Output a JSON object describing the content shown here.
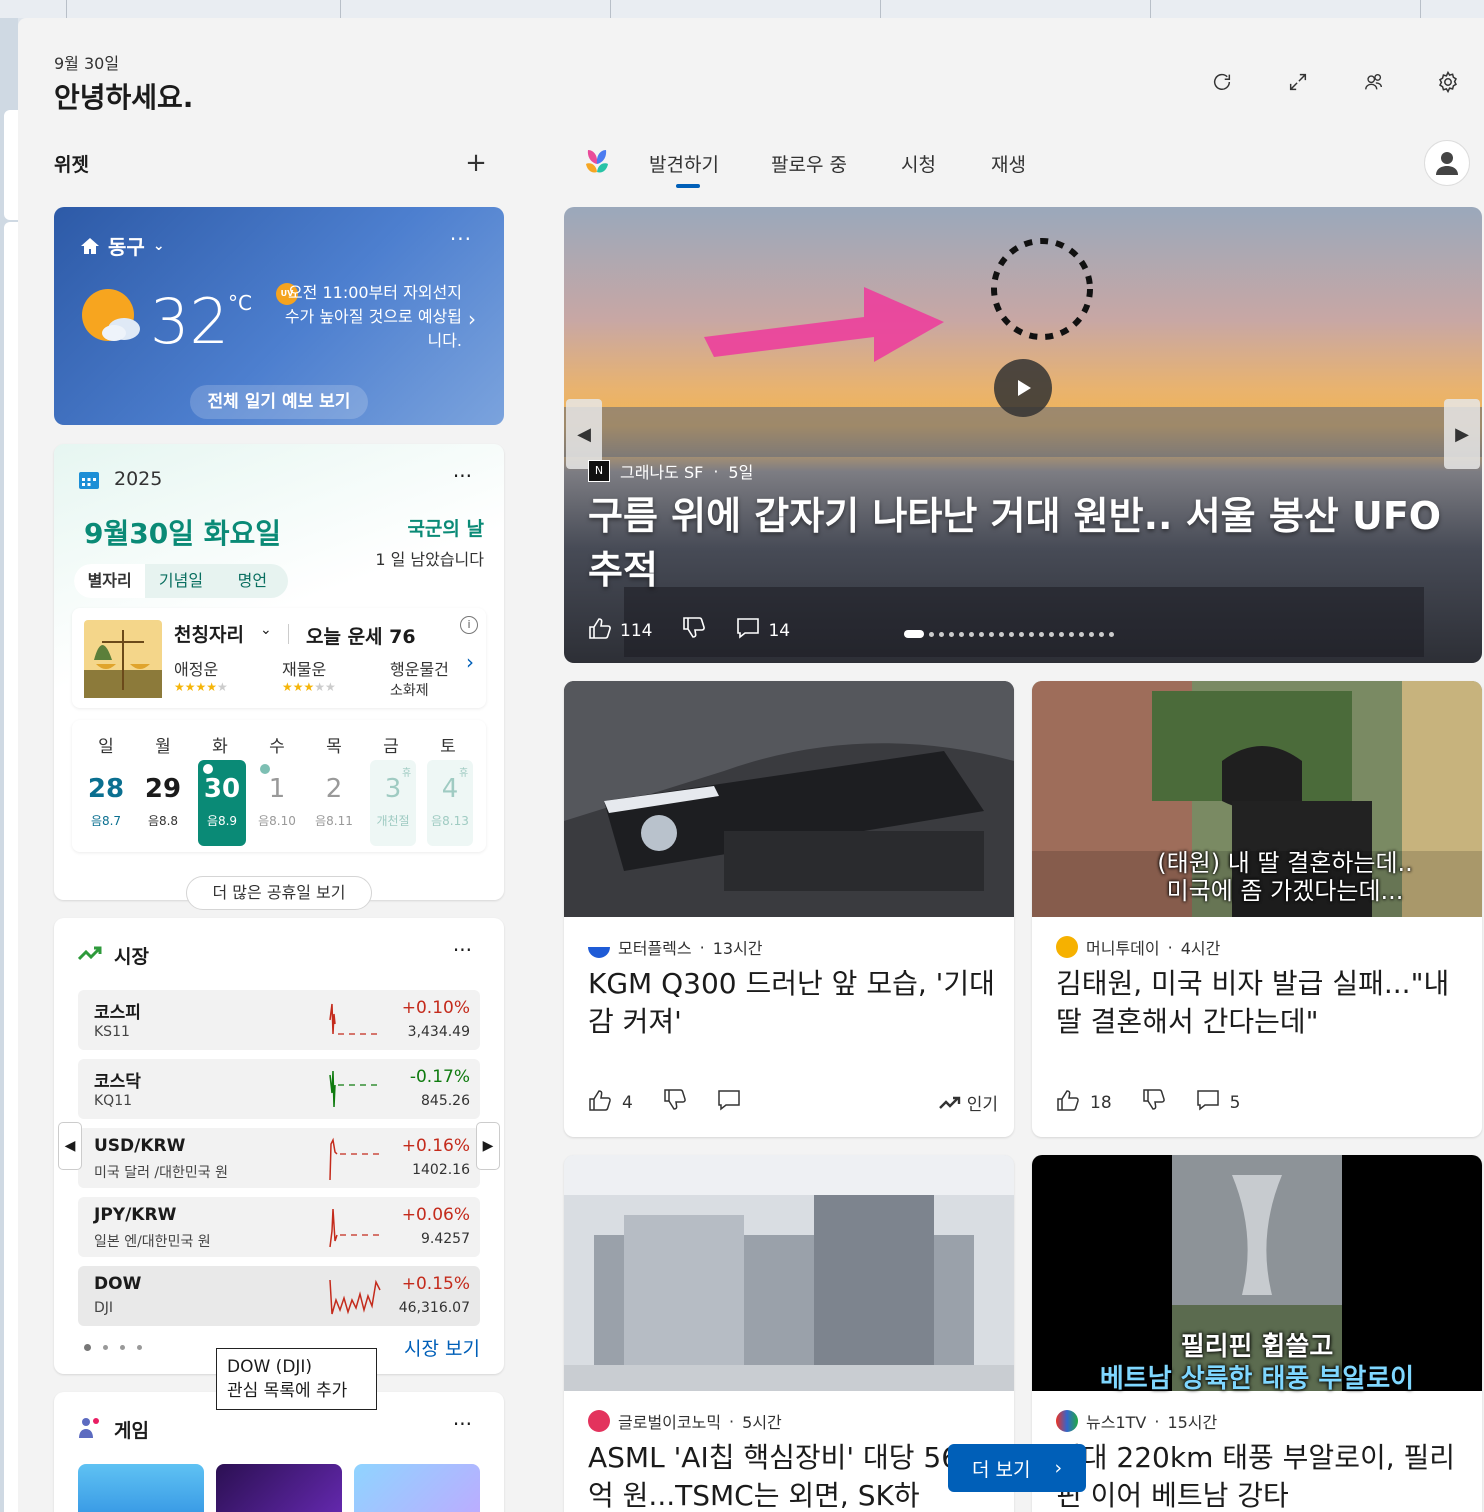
{
  "header": {
    "date": "9월 30일",
    "greeting": "안녕하세요."
  },
  "widgets": {
    "title": "위젯",
    "add_label": "+"
  },
  "feed_tabs": [
    {
      "label": "발견하기",
      "active": true
    },
    {
      "label": "팔로우 중",
      "active": false
    },
    {
      "label": "시청",
      "active": false
    },
    {
      "label": "재생",
      "active": false
    }
  ],
  "weather": {
    "location": "동구",
    "temperature": "32",
    "unit": "°C",
    "uv_badge": "UV",
    "description": "오전 11:00부터 자외선지수가 높아질 것으로 예상됩니다.",
    "forecast_button": "전체 일기 예보 보기",
    "more": "···"
  },
  "calendar": {
    "year": "2025",
    "date": "9월30일 화요일",
    "holiday": "국군의 날",
    "remaining": "1 일 남았습니다",
    "tabs": [
      "별자리",
      "기념일",
      "명언"
    ],
    "horoscope": {
      "sign": "천칭자리",
      "fortune_label": "오늘 운세 76",
      "items": [
        {
          "label": "애정운",
          "stars": 4
        },
        {
          "label": "재물운",
          "stars": 3
        },
        {
          "label": "행운물건",
          "value": "소화제"
        }
      ]
    },
    "weekdays": [
      "일",
      "월",
      "화",
      "수",
      "목",
      "금",
      "토"
    ],
    "days": [
      {
        "num": "28",
        "lunar": "음8.7",
        "style": "sun"
      },
      {
        "num": "29",
        "lunar": "음8.8",
        "style": "normal"
      },
      {
        "num": "30",
        "lunar": "음8.9",
        "style": "today"
      },
      {
        "num": "1",
        "lunar": "음8.10",
        "style": "faded"
      },
      {
        "num": "2",
        "lunar": "음8.11",
        "style": "faded"
      },
      {
        "num": "3",
        "lunar": "개천절",
        "style": "holiday",
        "badge": "휴"
      },
      {
        "num": "4",
        "lunar": "음8.13",
        "style": "holiday",
        "badge": "휴"
      }
    ],
    "more_button": "더 많은 공휴일 보기"
  },
  "market": {
    "title": "시장",
    "rows": [
      {
        "name": "코스피",
        "sub": "KS11",
        "pct": "+0.10%",
        "value": "3,434.49",
        "up": true
      },
      {
        "name": "코스닥",
        "sub": "KQ11",
        "pct": "-0.17%",
        "value": "845.26",
        "up": false
      },
      {
        "name": "USD/KRW",
        "sub": "미국 달러 /대한민국 원",
        "pct": "+0.16%",
        "value": "1402.16",
        "up": true
      },
      {
        "name": "JPY/KRW",
        "sub": "일본 엔/대한민국 원",
        "pct": "+0.06%",
        "value": "9.4257",
        "up": true
      },
      {
        "name": "DOW",
        "sub": "DJI",
        "pct": "+0.15%",
        "value": "46,316.07",
        "up": true
      }
    ],
    "link": "시장 보기",
    "tooltip_line1": "DOW (DJI)",
    "tooltip_line2": "관심 목록에 추가"
  },
  "game": {
    "title": "게임"
  },
  "hero": {
    "source": "그래나도 SF",
    "age": "5일",
    "title": "구름 위에 갑자기 나타난 거대 원반.. 서울 봉산 UFO 추적",
    "likes": "114",
    "comments": "14"
  },
  "cards": [
    {
      "source": "모터플렉스",
      "age": "13시간",
      "title": "KGM Q300 드러난 앞 모습, '기대감 커져'",
      "likes": "4",
      "comments": "",
      "trend": "인기"
    },
    {
      "source": "머니투데이",
      "age": "4시간",
      "title": "김태원, 미국 비자 발급 실패...\"내 딸 결혼해서 간다는데\"",
      "likes": "18",
      "comments": "5",
      "trend": "",
      "overlay1": "(태원) 내 딸 결혼하는데..",
      "overlay2": "미국에 좀 가겠다는데..."
    },
    {
      "source": "글로벌이코노믹",
      "age": "5시간",
      "title": "ASML 'AI칩 핵심장비' 대당 5600억 원...TSMC는 외면, SK하",
      "likes": "",
      "comments": "",
      "trend": ""
    },
    {
      "source": "뉴스1TV",
      "age": "15시간",
      "title": "최대 220km 태풍 부알로이, 필리핀 이어 베트남 강타",
      "likes": "",
      "comments": "",
      "trend": "",
      "overlay1": "필리핀 휩쓸고",
      "overlay2": "베트남 상륙한 태풍 부알로이"
    }
  ],
  "more_button": "더 보기",
  "colors": {
    "accent": "#005fb8",
    "teal": "#0a8a76",
    "up": "#c42b1c",
    "down": "#0f7b0f"
  }
}
